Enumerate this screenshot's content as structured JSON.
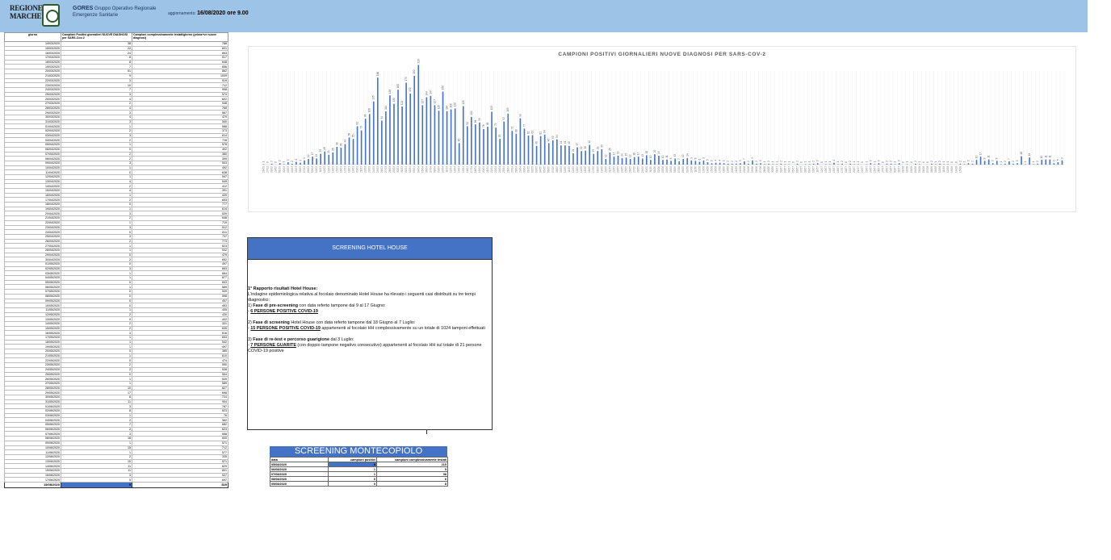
{
  "header": {
    "logo_lines": [
      "REGIONE",
      "MARCHE"
    ],
    "org_name": "GORES",
    "org_line1": "Gruppo Operativo Regionale",
    "org_line2": "Emergenze Sanitarie",
    "update_label": "aggiornamento:",
    "update_value": "16/08/2020 ore 9.00"
  },
  "colors": {
    "banner": "#9dc3e6",
    "accent": "#4472c4",
    "bars": "#4472c4"
  },
  "table": {
    "headers": [
      "giorno",
      "Campioni Positivi giornalieri NUOVE DIAGNOSI per SARS-Cov-2",
      "Campioni complessivamente testati/giorno (prima+ve nuove diagnosi)"
    ],
    "rows": [
      [
        "14/03/2020",
        "38",
        "788"
      ],
      [
        "15/03/2020",
        "22",
        "601"
      ],
      [
        "16/03/2020",
        "24",
        "663"
      ],
      [
        "17/03/2020",
        "8",
        "517"
      ],
      [
        "18/03/2020",
        "8",
        "648"
      ],
      [
        "19/03/2020",
        "7",
        "856"
      ],
      [
        "20/03/2020",
        "51",
        "862"
      ],
      [
        "21/03/2020",
        "9",
        "1009"
      ],
      [
        "22/03/2020",
        "3",
        "519"
      ],
      [
        "23/03/2020",
        "10",
        "712"
      ],
      [
        "24/03/2020",
        "7",
        "998"
      ],
      [
        "25/03/2020",
        "3",
        "574"
      ],
      [
        "26/03/2020",
        "4",
        "602"
      ],
      [
        "27/03/2020",
        "2",
        "948"
      ],
      [
        "28/03/2020",
        "4",
        "768"
      ],
      [
        "29/03/2020",
        "3",
        "587"
      ],
      [
        "30/03/2020",
        "4",
        "479"
      ],
      [
        "31/03/2020",
        "3",
        "540"
      ],
      [
        "01/04/2020",
        "1",
        "588"
      ],
      [
        "02/04/2020",
        "2",
        "373"
      ],
      [
        "03/04/2020",
        "3",
        "614"
      ],
      [
        "04/04/2020",
        "2",
        "728"
      ],
      [
        "05/04/2020",
        "1",
        "578"
      ],
      [
        "06/04/2020",
        "0",
        "402"
      ],
      [
        "07/04/2020",
        "2",
        "380"
      ],
      [
        "08/04/2020",
        "2",
        "399"
      ],
      [
        "09/04/2020",
        "3",
        "503"
      ],
      [
        "10/04/2020",
        "1",
        "492"
      ],
      [
        "11/04/2020",
        "0",
        "638"
      ],
      [
        "12/04/2020",
        "1",
        "547"
      ],
      [
        "13/04/2020",
        "4",
        "549"
      ],
      [
        "14/04/2020",
        "2",
        "412"
      ],
      [
        "15/04/2020",
        "4",
        "391"
      ],
      [
        "16/04/2020",
        "1",
        "439"
      ],
      [
        "17/04/2020",
        "2",
        "653"
      ],
      [
        "18/04/2020",
        "0",
        "777"
      ],
      [
        "19/04/2020",
        "1",
        "614"
      ],
      [
        "20/04/2020",
        "3",
        "539"
      ],
      [
        "21/04/2020",
        "2",
        "648"
      ],
      [
        "22/04/2020",
        "1",
        "719"
      ],
      [
        "23/04/2020",
        "3",
        "512"
      ],
      [
        "24/04/2020",
        "0",
        "611"
      ],
      [
        "25/04/2020",
        "3",
        "737"
      ],
      [
        "26/04/2020",
        "2",
        "773"
      ],
      [
        "27/04/2020",
        "1",
        "623"
      ],
      [
        "28/04/2020",
        "1",
        "532"
      ],
      [
        "29/04/2020",
        "0",
        "479"
      ],
      [
        "30/04/2020",
        "2",
        "652"
      ],
      [
        "01/05/2020",
        "0",
        "497"
      ],
      [
        "02/05/2020",
        "3",
        "663"
      ],
      [
        "03/05/2020",
        "1",
        "664"
      ],
      [
        "04/05/2020",
        "1",
        "877"
      ],
      [
        "05/05/2020",
        "0",
        "603"
      ],
      [
        "06/05/2020",
        "1",
        "589"
      ],
      [
        "07/05/2020",
        "0",
        "539"
      ],
      [
        "08/05/2020",
        "0",
        "598"
      ],
      [
        "09/05/2020",
        "0",
        "457"
      ],
      [
        "10/05/2020",
        "0",
        "453"
      ],
      [
        "11/05/2020",
        "1",
        "405"
      ],
      [
        "12/05/2020",
        "2",
        "430"
      ],
      [
        "13/05/2020",
        "0",
        "402"
      ],
      [
        "14/05/2020",
        "2",
        "331"
      ],
      [
        "15/05/2020",
        "2",
        "635"
      ],
      [
        "16/05/2020",
        "3",
        "616"
      ],
      [
        "17/05/2020",
        "1",
        "653"
      ],
      [
        "18/05/2020",
        "1",
        "542"
      ],
      [
        "19/05/2020",
        "1",
        "497"
      ],
      [
        "20/05/2020",
        "0",
        "385"
      ],
      [
        "21/05/2020",
        "1",
        "610"
      ],
      [
        "22/05/2020",
        "0",
        "474"
      ],
      [
        "23/05/2020",
        "2",
        "590"
      ],
      [
        "24/05/2020",
        "2",
        "538"
      ],
      [
        "25/05/2020",
        "0",
        "504"
      ],
      [
        "26/05/2020",
        "1",
        "539"
      ],
      [
        "27/05/2020",
        "1",
        "589"
      ],
      [
        "28/05/2020",
        "10",
        "827"
      ],
      [
        "29/05/2020",
        "17",
        "698"
      ],
      [
        "30/05/2020",
        "8",
        "724"
      ],
      [
        "31/05/2020",
        "11",
        "904"
      ],
      [
        "01/06/2020",
        "3",
        "787"
      ],
      [
        "02/06/2020",
        "8",
        "523"
      ],
      [
        "03/06/2020",
        "1",
        "76"
      ],
      [
        "04/06/2020",
        "2",
        "382"
      ],
      [
        "05/06/2020",
        "7",
        "682"
      ],
      [
        "06/06/2020",
        "2",
        "623"
      ],
      [
        "07/06/2020",
        "3",
        "658"
      ],
      [
        "08/06/2020",
        "18",
        "600"
      ],
      [
        "09/06/2020",
        "1",
        "571"
      ],
      [
        "10/06/2020",
        "15",
        "712"
      ],
      [
        "11/06/2020",
        "1",
        "577"
      ],
      [
        "12/06/2020",
        "2",
        "335"
      ],
      [
        "13/06/2020",
        "10",
        "571"
      ],
      [
        "14/06/2020",
        "11",
        "629"
      ],
      [
        "15/06/2020",
        "11",
        "601"
      ],
      [
        "16/06/2020",
        "3",
        "527"
      ],
      [
        "17/06/2020",
        "5",
        "697"
      ]
    ],
    "last_row": [
      "15/08/2020",
      "9",
      "529"
    ]
  },
  "chart_data": {
    "type": "bar",
    "title": "CAMPIONI POSITIVI GIORNALIERI NUOVE DIAGNOSI PER SARS-COV-2",
    "xlabel": "",
    "ylabel": "",
    "ylim": [
      0,
      200
    ],
    "grid": true,
    "legend": "none",
    "categories": [
      "26/02",
      "27/02",
      "28/02",
      "29/02",
      "01/03",
      "02/03",
      "03/03",
      "04/03",
      "05/03",
      "06/03",
      "07/03",
      "08/03",
      "09/03",
      "10/03",
      "11/03",
      "12/03",
      "13/03",
      "14/03",
      "15/03",
      "16/03",
      "17/03",
      "18/03",
      "19/03",
      "20/03",
      "21/03",
      "22/03",
      "23/03",
      "24/03",
      "25/03",
      "26/03",
      "27/03",
      "28/03",
      "29/03",
      "30/03",
      "31/03",
      "01/04",
      "02/04",
      "03/04",
      "04/04",
      "05/04",
      "06/04",
      "07/04",
      "08/04",
      "09/04",
      "10/04",
      "11/04",
      "12/04",
      "13/04",
      "14/04",
      "15/04",
      "16/04",
      "17/04",
      "18/04",
      "19/04",
      "20/04",
      "21/04",
      "22/04",
      "23/04",
      "24/04",
      "25/04",
      "26/04",
      "27/04",
      "28/04",
      "29/04",
      "30/04",
      "01/05",
      "02/05",
      "03/05",
      "04/05",
      "05/05",
      "06/05",
      "07/05",
      "08/05",
      "09/05",
      "10/05",
      "11/05",
      "12/05",
      "13/05",
      "14/05",
      "15/05",
      "16/05",
      "17/05",
      "18/05",
      "19/05",
      "20/05",
      "21/05",
      "22/05",
      "23/05",
      "24/05",
      "25/05",
      "26/05",
      "27/05",
      "28/05",
      "29/05",
      "30/05",
      "31/05",
      "01/06",
      "02/06",
      "03/06",
      "04/06",
      "05/06",
      "06/06",
      "07/06",
      "08/06",
      "09/06",
      "10/06",
      "11/06",
      "12/06",
      "13/06",
      "14/06",
      "15/06",
      "16/06",
      "17/06",
      "18/06",
      "19/06",
      "20/06",
      "21/06",
      "22/06",
      "23/06",
      "24/06",
      "25/06",
      "26/06",
      "27/06",
      "28/06",
      "29/06",
      "30/06",
      "01/07",
      "02/07",
      "03/07",
      "04/07",
      "05/07",
      "06/07",
      "07/07",
      "08/07",
      "09/07",
      "10/07",
      "11/07",
      "12/07",
      "13/07",
      "14/07",
      "15/07",
      "16/07",
      "17/07",
      "18/07",
      "19/07",
      "20/07",
      "21/07",
      "22/07",
      "23/07",
      "24/07",
      "25/07",
      "26/07",
      "27/07",
      "28/07",
      "29/07",
      "30/07",
      "31/07",
      "01/08",
      "02/08",
      "03/08",
      "04/08",
      "05/08",
      "06/08",
      "07/08",
      "08/08",
      "09/08",
      "10/08",
      "11/08",
      "12/08",
      "13/08",
      "14/08",
      "15/08"
    ],
    "values": [
      1,
      0,
      2,
      0,
      3,
      1,
      5,
      2,
      6,
      4,
      9,
      12,
      17,
      13,
      23,
      28,
      21,
      26,
      38,
      36,
      44,
      58,
      55,
      82,
      73,
      98,
      108,
      135,
      186,
      94,
      114,
      148,
      130,
      160,
      124,
      175,
      152,
      190,
      213,
      127,
      144,
      147,
      127,
      115,
      156,
      114,
      118,
      120,
      46,
      125,
      82,
      102,
      86,
      90,
      76,
      81,
      113,
      79,
      55,
      92,
      109,
      72,
      66,
      99,
      77,
      62,
      63,
      40,
      61,
      64,
      46,
      52,
      54,
      41,
      41,
      40,
      24,
      37,
      29,
      30,
      42,
      23,
      29,
      33,
      12,
      26,
      17,
      19,
      14,
      15,
      12,
      16,
      17,
      13,
      20,
      10,
      22,
      19,
      10,
      11,
      8,
      13,
      7,
      12,
      14,
      9,
      8,
      6,
      9,
      5,
      3,
      4,
      4,
      3,
      2,
      2,
      2,
      3,
      7,
      2,
      9,
      2,
      3,
      1,
      2,
      1,
      1,
      2,
      1,
      1,
      0,
      2,
      0,
      1,
      1,
      2,
      3,
      0,
      1,
      1,
      4,
      1,
      2,
      0,
      2,
      1,
      1,
      0,
      1,
      3,
      1,
      3,
      0,
      2,
      2,
      1,
      3,
      0,
      1,
      0,
      2,
      1,
      0,
      0,
      2,
      1,
      2,
      1,
      1,
      0,
      0,
      2,
      1,
      3,
      2,
      10,
      17,
      8,
      11,
      3,
      8,
      1,
      2,
      7,
      2,
      3,
      18,
      1,
      15,
      1,
      2,
      10,
      11,
      11,
      3,
      5,
      9
    ]
  },
  "hotel_house": {
    "title": "SCREENING HOTEL HOUSE",
    "p1": "1° Rapporto  risultati Hotel House:",
    "p2": "L'indagine epidemiologica relativa al focolaio denominato Hotel House ha rilevato i seguenti casi distribuiti su tre tempi diagnostici:",
    "p3a_num": "1) ",
    "p3a_bold": "Fase di pre-screening",
    "p3a_rest": " con data referto tampone dal 9 al 17 Giugno:",
    "p3b_dash": "- ",
    "p3b_u": "6 PERSONE POSITIVE COVID-19",
    "p4a_num": "2) ",
    "p4a_bold": "Fase di screening",
    "p4a_rest": " Hotel House con data referto tampone dal 18 Giugno al 7 Luglio:",
    "p4b_dash": "- ",
    "p4b_u": "15 PERSONE POSITIVE COVID-19",
    "p4b_rest": " appartenenti al focolaio HH complessivamente su un totale di 1024 tamponi effettuati",
    "p5a_num": "3) ",
    "p5a_bold": "Fase di re-test e percorso guarigione",
    "p5a_rest": " dal 3 Luglio:",
    "p5b_dash": "- ",
    "p5b_u": "7 PERSONE GUARITE",
    "p5b_rest": " (con doppio tampone negativo consecutivo) appartenenti al focolaio HH sul totale di 21 persone COVID-19 positive"
  },
  "montecopiolo": {
    "title": "SCREENING MONTECOPIOLO",
    "headers": [
      "data",
      "campioni positivi",
      "campioni complessivamente testati"
    ],
    "rows": [
      [
        "05/08/2020",
        "8",
        "215"
      ],
      [
        "06/08/2020",
        "1",
        "5"
      ],
      [
        "07/08/2020",
        "1",
        "38"
      ],
      [
        "08/08/2020",
        "0",
        "6"
      ],
      [
        "09/08/2020",
        "0",
        "8"
      ]
    ]
  }
}
